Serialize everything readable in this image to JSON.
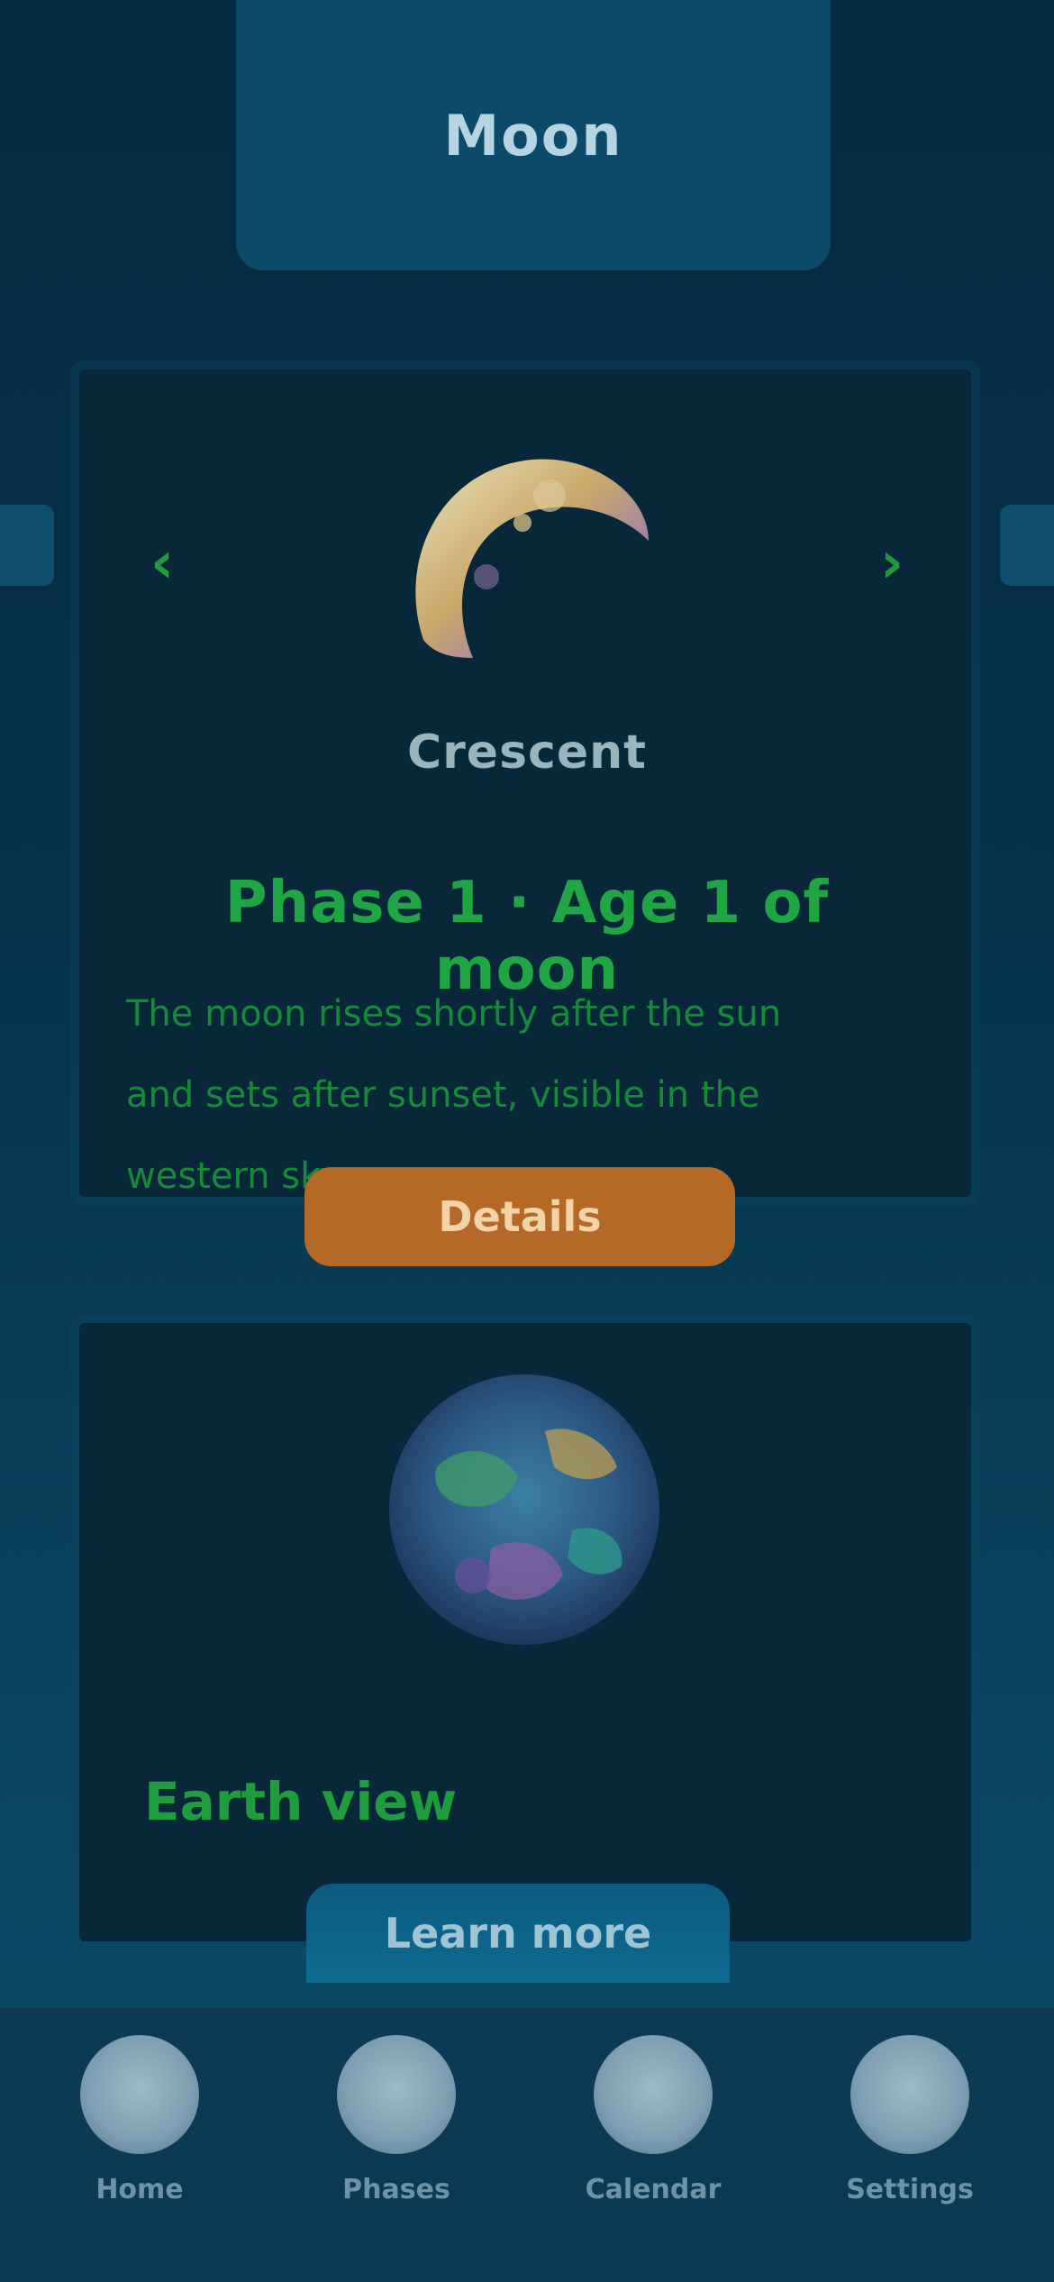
{
  "header": {
    "title": "Moon"
  },
  "card_1": {
    "prev_label": "‹",
    "next_label": "›",
    "image_icon": "moon-image",
    "planet_name": "Crescent",
    "title": "Phase 1 · Age 1 of moon",
    "description": "The moon rises shortly after the sun and sets after sunset, visible in the western sky."
  },
  "orange_button": {
    "label": "Details"
  },
  "card_2": {
    "image_icon": "globe-image",
    "subtitle": "Earth view"
  },
  "blue_button": {
    "label": "Learn more"
  },
  "bottom_nav": {
    "items": [
      {
        "label": "Home",
        "icon": "home-icon"
      },
      {
        "label": "Phases",
        "icon": "phases-icon"
      },
      {
        "label": "Calendar",
        "icon": "calendar-icon"
      },
      {
        "label": "Settings",
        "icon": "settings-icon"
      }
    ]
  },
  "colors": {
    "background": "#062a3f",
    "card": "#082739",
    "green": "#1fa544",
    "orange": "#b46a26",
    "blue": "#0e6a92"
  }
}
